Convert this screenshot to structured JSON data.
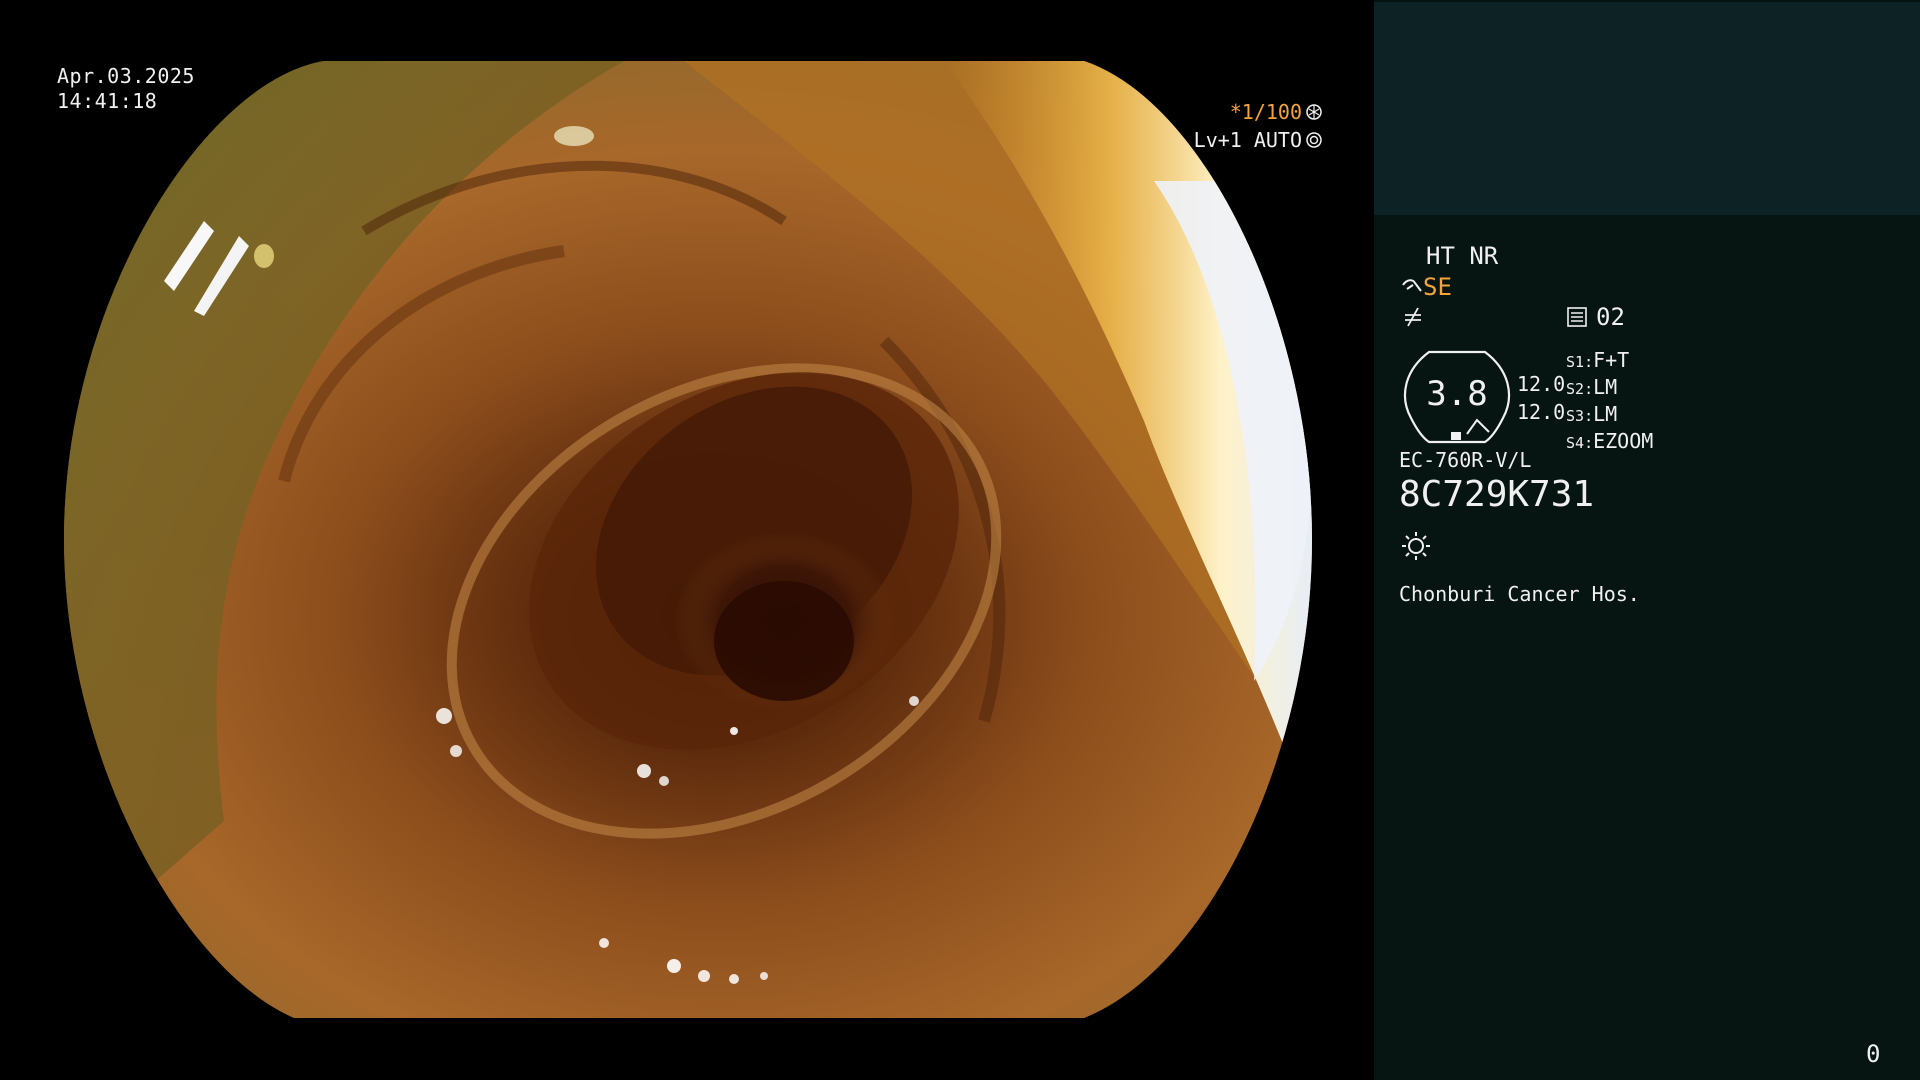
{
  "overlay": {
    "date": "Apr.03.2025",
    "time": "14:41:18",
    "shutter": "*1/100",
    "level": "Lv+1",
    "iris": "AUTO",
    "shutter_icon": "aperture-icon",
    "iris_icon": "ring-icon"
  },
  "panel": {
    "modes": "HT NR",
    "se_label": "SE",
    "se_icon": "curve-hook-icon",
    "slash_icon": "not-equal-icon",
    "record_icon": "memory-card-icon",
    "record_count": "02",
    "gauge": {
      "value": "3.8",
      "upper": "12.0",
      "lower": "12.0"
    },
    "switches": [
      {
        "key": "S1",
        "value": "F+T"
      },
      {
        "key": "S2",
        "value": "LM"
      },
      {
        "key": "S3",
        "value": "LM"
      },
      {
        "key": "S4",
        "value": "EZOOM"
      }
    ],
    "scope_model": "EC-760R-V/L",
    "serial": "8C729K731",
    "light_icon": "sun-icon",
    "hospital": "Chonburi Cancer Hos.",
    "counter": "0"
  },
  "colors": {
    "accent": "#f2a63a",
    "panel_top": "#0d2224",
    "panel_body": "#061512"
  }
}
